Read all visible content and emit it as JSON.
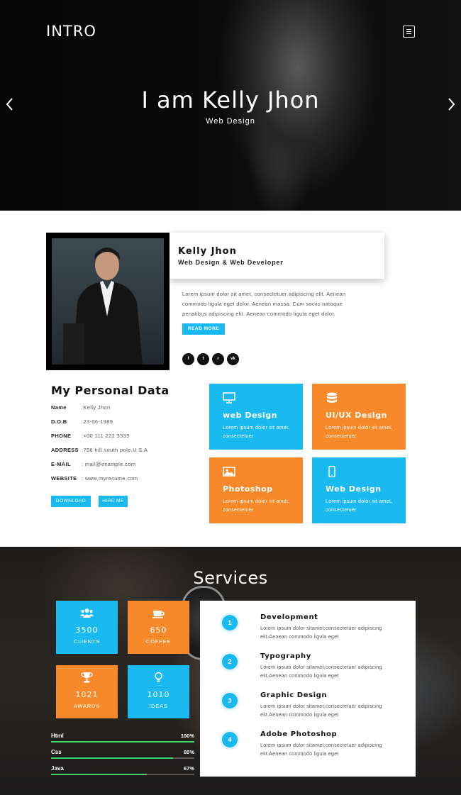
{
  "hero": {
    "logo": "INTRO",
    "title": "I am Kelly Jhon",
    "subtitle": "Web Design",
    "menu_icon": "menu-icon",
    "prev_icon": "chevron-left-icon",
    "next_icon": "chevron-right-icon"
  },
  "profile": {
    "name": "Kelly Jhon",
    "role": "Web Design & Web Developer",
    "bio": "Lorem ipsum dolor sit amet, consectetuer adipiscing elit. Aenean commodo ligula eget dolor. Aenean massa. Cum sociis natoque penatibus adipiscing elit. Aenean commodo ligula eget dolor.",
    "read_more": "READ MORE",
    "socials": [
      {
        "icon": "facebook-icon",
        "glyph": "f"
      },
      {
        "icon": "twitter-icon",
        "glyph": "t"
      },
      {
        "icon": "rss-icon",
        "glyph": "r"
      },
      {
        "icon": "vk-icon",
        "glyph": "vk"
      }
    ]
  },
  "personal": {
    "title": "My Personal Data",
    "rows": [
      {
        "key": "Name",
        "value": ":Kelly Jhon"
      },
      {
        "key": "D.O.B",
        "value": ":23-06-1989"
      },
      {
        "key": "PHONE",
        "value": ":+00 111 222 3333"
      },
      {
        "key": "ADDRESS",
        "value": ":756 hill,south pole,U.S.A"
      },
      {
        "key": "E-MAIL",
        "value": ": mail@example.com"
      },
      {
        "key": "WEBSITE",
        "value": ": www.myresume.com"
      }
    ],
    "download": "DOWNLOAD",
    "hire": "HIRE ME"
  },
  "features": [
    {
      "title": "web Design",
      "desc": "Lorem ipsum dolor sit amet, consectetuer",
      "color": "#1ab9ef",
      "icon": "monitor-icon"
    },
    {
      "title": "UI/UX Design",
      "desc": "Lorem ipsum dolor sit amet, consectetuer",
      "color": "#f7892b",
      "icon": "database-icon"
    },
    {
      "title": "Photoshop",
      "desc": "Lorem ipsum dolor sit amet, consectetuer",
      "color": "#f7892b",
      "icon": "image-icon"
    },
    {
      "title": "Web Design",
      "desc": "Lorem ipsum dolor sit amet, consectetuer",
      "color": "#1ab9ef",
      "icon": "mobile-icon"
    }
  ],
  "services": {
    "title": "Services",
    "stats": [
      {
        "value": "3500",
        "label": "CLIENTS",
        "color": "#1ab9ef",
        "icon": "users-icon"
      },
      {
        "value": "650",
        "label": "COFFEE",
        "color": "#f7892b",
        "icon": "coffee-icon"
      },
      {
        "value": "1021",
        "label": "AWARDS",
        "color": "#f7892b",
        "icon": "trophy-icon"
      },
      {
        "value": "1010",
        "label": "IDEAS",
        "color": "#1ab9ef",
        "icon": "lightbulb-icon"
      }
    ],
    "skills": [
      {
        "name": "Html",
        "percent_label": "100%",
        "level": 1.0
      },
      {
        "name": "Css",
        "percent_label": "85%",
        "level": 0.85
      },
      {
        "name": "Java",
        "percent_label": "67%",
        "level": 0.67
      }
    ],
    "items": [
      {
        "num": "1",
        "title": "Development",
        "desc": "Lorem ipsum dolor sitamet,consectetuer adipiscing elit.Aenean commodo ligula eget"
      },
      {
        "num": "2",
        "title": "Typography",
        "desc": "Lorem ipsum dolor sitamet,consectetuer adipiscing elit.Aenean commodo ligula eget"
      },
      {
        "num": "3",
        "title": "Graphic Design",
        "desc": "Lorem ipsum dolor sitamet,consectetuer adipiscing elit.Aenean commodo ligula eget"
      },
      {
        "num": "4",
        "title": "Adobe Photoshop",
        "desc": "Lorem ipsum dolor sitamet,consectetuer adipiscing elit.Aenean commodo ligula eget"
      }
    ]
  },
  "colors": {
    "accent_blue": "#1ab9ef",
    "accent_orange": "#f7892b",
    "skill_green": "#3fd36a"
  }
}
